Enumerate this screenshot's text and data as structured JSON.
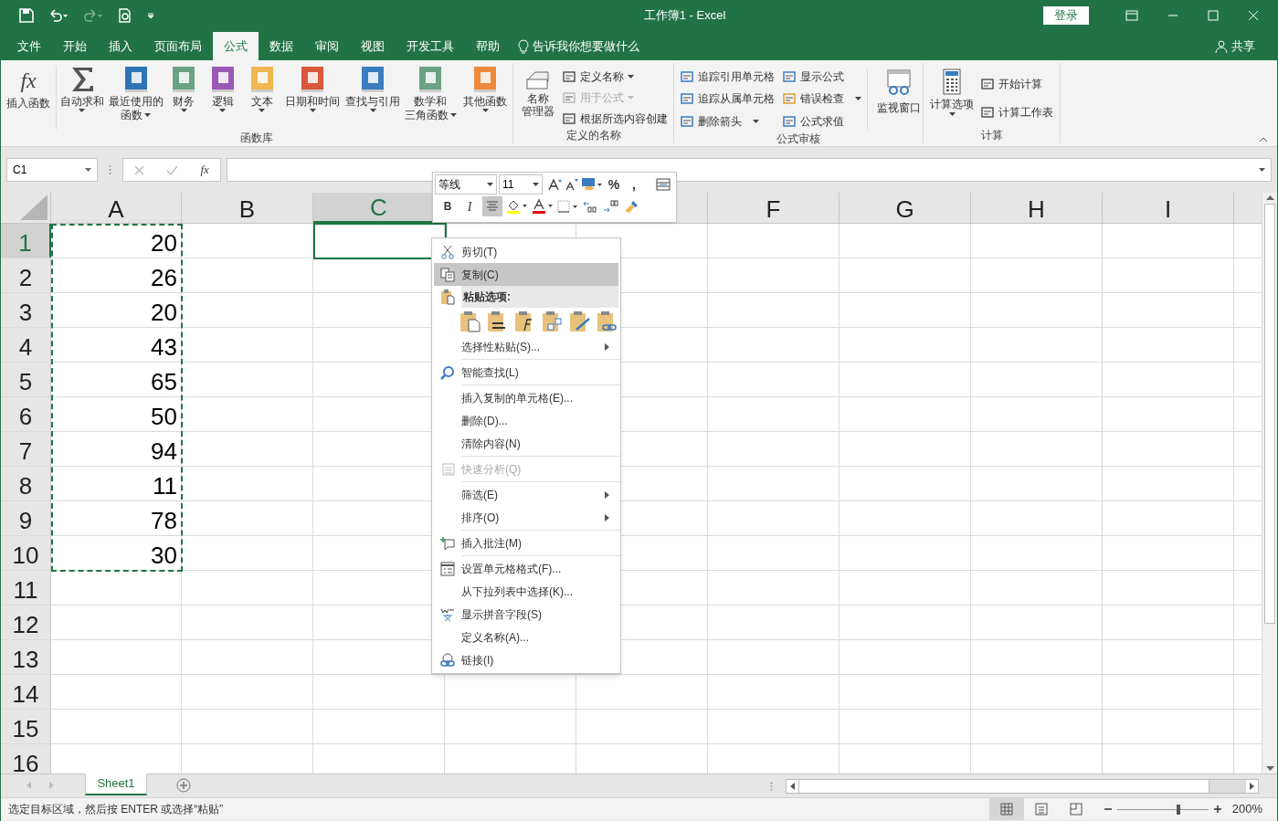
{
  "title_bar": {
    "title": "工作簿1  -  Excel",
    "login": "登录"
  },
  "ribbon_tabs": [
    {
      "label": "文件",
      "selected": false
    },
    {
      "label": "开始",
      "selected": false
    },
    {
      "label": "插入",
      "selected": false
    },
    {
      "label": "页面布局",
      "selected": false
    },
    {
      "label": "公式",
      "selected": true
    },
    {
      "label": "数据",
      "selected": false
    },
    {
      "label": "审阅",
      "selected": false
    },
    {
      "label": "视图",
      "selected": false
    },
    {
      "label": "开发工具",
      "selected": false
    },
    {
      "label": "帮助",
      "selected": false
    }
  ],
  "tell_me": "告诉我你想要做什么",
  "share": "共享",
  "function_library": {
    "label": "函数库",
    "insert_function": {
      "glyph": "fx",
      "label": "插入函数"
    },
    "buttons": [
      {
        "label": "自动求和",
        "dropdown": true
      },
      {
        "label": "最近使用的函数",
        "dropdown": true
      },
      {
        "label": "财务",
        "dropdown": true
      },
      {
        "label": "逻辑",
        "dropdown": true
      },
      {
        "label": "文本",
        "dropdown": true
      },
      {
        "label": "日期和时间",
        "dropdown": true
      },
      {
        "label": "查找与引用",
        "dropdown": true
      },
      {
        "label": "数学和三角函数",
        "dropdown": true
      },
      {
        "label": "其他函数",
        "dropdown": true
      }
    ]
  },
  "defined_names": {
    "label": "定义的名称",
    "manager": "名称管理器",
    "items": [
      {
        "label": "定义名称",
        "dropdown": true,
        "disabled": false
      },
      {
        "label": "用于公式",
        "dropdown": true,
        "disabled": true
      },
      {
        "label": "根据所选内容创建",
        "dropdown": false,
        "disabled": false
      }
    ]
  },
  "formula_auditing": {
    "label": "公式审核",
    "items": [
      {
        "label": "追踪引用单元格",
        "dropdown": false
      },
      {
        "label": "追踪从属单元格",
        "dropdown": false
      },
      {
        "label": "删除箭头",
        "dropdown": true
      },
      {
        "label": "显示公式",
        "dropdown": false
      },
      {
        "label": "错误检查",
        "dropdown": true
      },
      {
        "label": "公式求值",
        "dropdown": false
      }
    ],
    "watch": "监视窗口"
  },
  "calculation": {
    "label": "计算",
    "options": "计算选项",
    "items": [
      "开始计算",
      "计算工作表"
    ]
  },
  "formula_bar": {
    "name_box": "C1",
    "fx": "fx"
  },
  "sheet": {
    "columns": [
      {
        "label": "A",
        "selected": false
      },
      {
        "label": "B",
        "selected": false
      },
      {
        "label": "C",
        "selected": true
      },
      {},
      {},
      {
        "label": "F",
        "selected": false
      },
      {
        "label": "G",
        "selected": false
      },
      {
        "label": "H",
        "selected": false
      },
      {
        "label": "I",
        "selected": false
      }
    ],
    "rows": [
      {
        "label": "1",
        "selected": true,
        "a": "20"
      },
      {
        "label": "2",
        "selected": false,
        "a": "26"
      },
      {
        "label": "3",
        "selected": false,
        "a": "20"
      },
      {
        "label": "4",
        "selected": false,
        "a": "43"
      },
      {
        "label": "5",
        "selected": false,
        "a": "65"
      },
      {
        "label": "6",
        "selected": false,
        "a": "50"
      },
      {
        "label": "7",
        "selected": false,
        "a": "94"
      },
      {
        "label": "8",
        "selected": false,
        "a": "11"
      },
      {
        "label": "9",
        "selected": false,
        "a": "78"
      },
      {
        "label": "10",
        "selected": false,
        "a": "30"
      },
      {
        "label": "11",
        "selected": false
      },
      {
        "label": "12",
        "selected": false
      },
      {
        "label": "13",
        "selected": false
      },
      {
        "label": "14",
        "selected": false
      },
      {
        "label": "15",
        "selected": false
      },
      {
        "label": "16",
        "selected": false
      }
    ]
  },
  "mini_toolbar": {
    "font": "等线",
    "size": "11",
    "percent": "%",
    "comma": ",",
    "bold": "B",
    "italic": "I",
    "center_selected": true
  },
  "context_menu": [
    {
      "kind": "item",
      "label": "剪切(T)",
      "highlighted": false,
      "disabled": false,
      "submenu": false
    },
    {
      "kind": "item",
      "label": "复制(C)",
      "highlighted": true,
      "disabled": false,
      "submenu": false
    },
    {
      "kind": "section",
      "label": "粘贴选项:"
    },
    {
      "kind": "paste_icons"
    },
    {
      "kind": "item",
      "label": "选择性粘贴(S)...",
      "highlighted": false,
      "disabled": false,
      "submenu": true
    },
    {
      "kind": "separator"
    },
    {
      "kind": "item",
      "label": "智能查找(L)",
      "highlighted": false,
      "disabled": false,
      "submenu": false
    },
    {
      "kind": "separator"
    },
    {
      "kind": "item",
      "label": "插入复制的单元格(E)...",
      "highlighted": false,
      "disabled": false,
      "submenu": false
    },
    {
      "kind": "item",
      "label": "删除(D)...",
      "highlighted": false,
      "disabled": false,
      "submenu": false
    },
    {
      "kind": "item",
      "label": "清除内容(N)",
      "highlighted": false,
      "disabled": false,
      "submenu": false
    },
    {
      "kind": "separator"
    },
    {
      "kind": "item",
      "label": "快速分析(Q)",
      "highlighted": false,
      "disabled": true,
      "submenu": false
    },
    {
      "kind": "separator"
    },
    {
      "kind": "item",
      "label": "筛选(E)",
      "highlighted": false,
      "disabled": false,
      "submenu": true
    },
    {
      "kind": "item",
      "label": "排序(O)",
      "highlighted": false,
      "disabled": false,
      "submenu": true
    },
    {
      "kind": "separator"
    },
    {
      "kind": "item",
      "label": "插入批注(M)",
      "highlighted": false,
      "disabled": false,
      "submenu": false
    },
    {
      "kind": "separator"
    },
    {
      "kind": "item",
      "label": "设置单元格格式(F)...",
      "highlighted": false,
      "disabled": false,
      "submenu": false
    },
    {
      "kind": "item",
      "label": "从下拉列表中选择(K)...",
      "highlighted": false,
      "disabled": false,
      "submenu": false
    },
    {
      "kind": "item",
      "label": "显示拼音字段(S)",
      "highlighted": false,
      "disabled": false,
      "submenu": false
    },
    {
      "kind": "item",
      "label": "定义名称(A)...",
      "highlighted": false,
      "disabled": false,
      "submenu": false
    },
    {
      "kind": "item",
      "label": "链接(I)",
      "highlighted": false,
      "disabled": false,
      "submenu": false
    }
  ],
  "sheet_tabs": [
    {
      "label": "Sheet1",
      "selected": true
    }
  ],
  "status_bar": {
    "message": "选定目标区域，然后按 ENTER 或选择“粘贴”",
    "views": [
      {
        "kind": "normal",
        "selected": true
      },
      {
        "kind": "page_layout",
        "selected": false
      },
      {
        "kind": "page_break",
        "selected": false
      }
    ],
    "zoom": {
      "level": 0.67
    },
    "zoom_label": "200%"
  }
}
